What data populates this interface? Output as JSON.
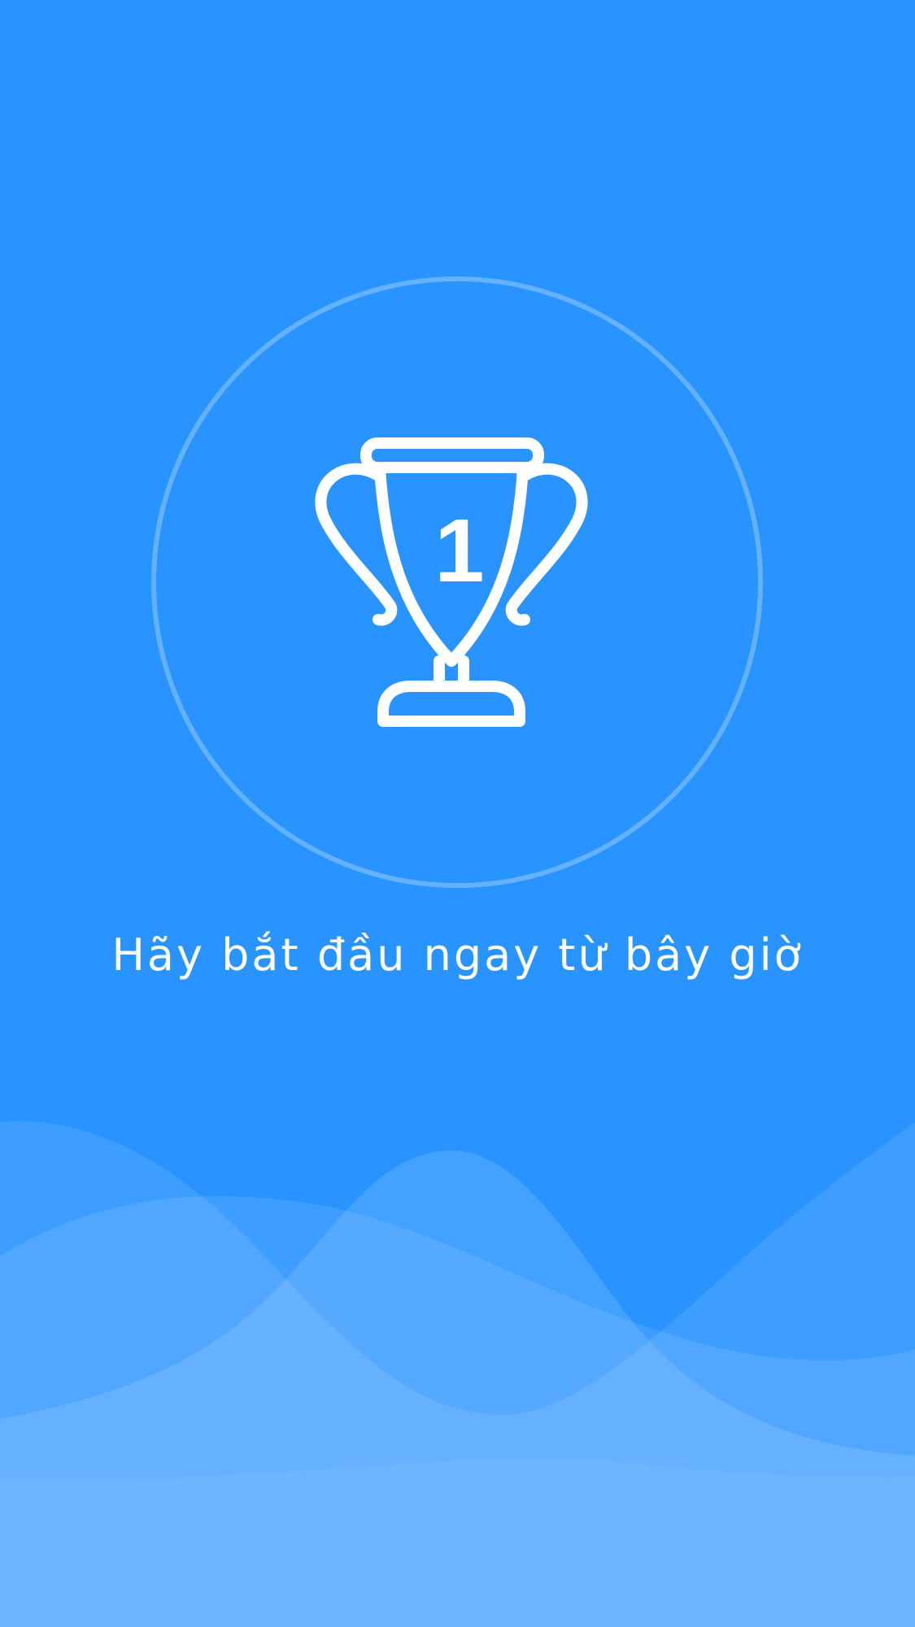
{
  "screen": {
    "background_color": "#2994FF",
    "accent_color": "#FFFFFF"
  },
  "hero": {
    "icon": "trophy-icon",
    "trophy_number": "1"
  },
  "headline": "Hãy bắt đầu ngay từ bây giờ"
}
